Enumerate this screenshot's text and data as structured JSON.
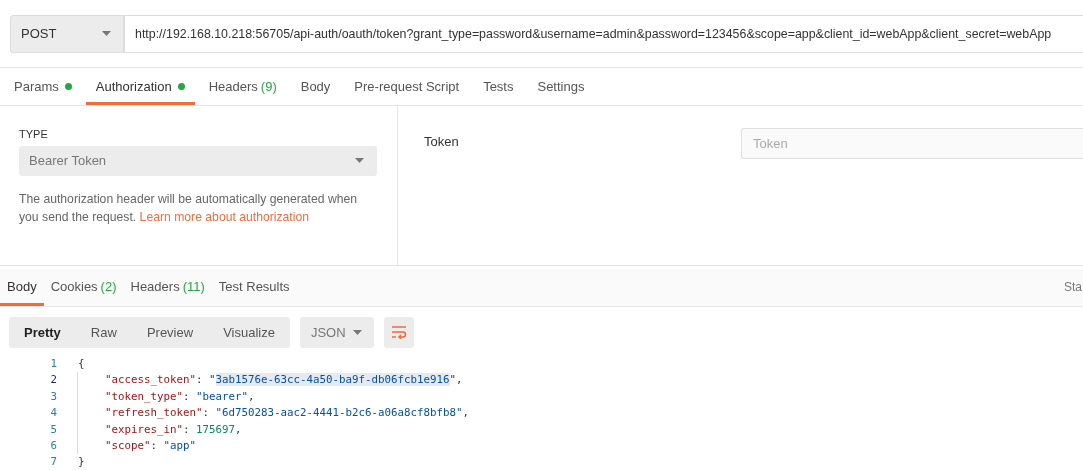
{
  "request": {
    "method": "POST",
    "url": "http://192.168.10.218:56705/api-auth/oauth/token?grant_type=password&username=admin&password=123456&scope=app&client_id=webApp&client_secret=webApp"
  },
  "request_tabs": [
    {
      "label": "Params",
      "dot": true,
      "selected": false
    },
    {
      "label": "Authorization",
      "dot": true,
      "selected": true
    },
    {
      "label": "Headers",
      "count": "(9)",
      "dot": false,
      "selected": false
    },
    {
      "label": "Body",
      "dot": false,
      "selected": false
    },
    {
      "label": "Pre-request Script",
      "dot": false,
      "selected": false
    },
    {
      "label": "Tests",
      "dot": false,
      "selected": false
    },
    {
      "label": "Settings",
      "dot": false,
      "selected": false
    }
  ],
  "authorization": {
    "type_label": "TYPE",
    "type_value": "Bearer Token",
    "help_text": "The authorization header will be automatically generated when you send the request.",
    "help_link": "Learn more about authorization",
    "token_label": "Token",
    "token_placeholder": "Token"
  },
  "response_tabs": [
    {
      "label": "Body",
      "selected": true
    },
    {
      "label": "Cookies",
      "count": "(2)",
      "selected": false
    },
    {
      "label": "Headers",
      "count": "(11)",
      "selected": false
    },
    {
      "label": "Test Results",
      "selected": false
    }
  ],
  "status_cut": "Sta",
  "view_modes": [
    {
      "label": "Pretty",
      "selected": true
    },
    {
      "label": "Raw",
      "selected": false
    },
    {
      "label": "Preview",
      "selected": false
    },
    {
      "label": "Visualize",
      "selected": false
    }
  ],
  "format": "JSON",
  "code_lines": [
    {
      "number": "1",
      "selected": false,
      "tokens": [
        {
          "kind": "punct",
          "text": "{",
          "highlighted": false
        }
      ]
    },
    {
      "number": "2",
      "selected": true,
      "tokens": [
        {
          "kind": "key",
          "text": "\"access_token\"",
          "highlighted": false
        },
        {
          "kind": "punct",
          "text": ": \"",
          "highlighted": false
        },
        {
          "kind": "string",
          "text": "3ab1576e-63cc-4a50-ba9f-db06fcb1e916",
          "highlighted": true
        },
        {
          "kind": "punct",
          "text": "\",",
          "highlighted": false
        }
      ]
    },
    {
      "number": "3",
      "selected": false,
      "tokens": [
        {
          "kind": "key",
          "text": "\"token_type\"",
          "highlighted": false
        },
        {
          "kind": "punct",
          "text": ": ",
          "highlighted": false
        },
        {
          "kind": "string",
          "text": "\"bearer\"",
          "highlighted": false
        },
        {
          "kind": "punct",
          "text": ",",
          "highlighted": false
        }
      ]
    },
    {
      "number": "4",
      "selected": false,
      "tokens": [
        {
          "kind": "key",
          "text": "\"refresh_token\"",
          "highlighted": false
        },
        {
          "kind": "punct",
          "text": ": ",
          "highlighted": false
        },
        {
          "kind": "string",
          "text": "\"6d750283-aac2-4441-b2c6-a06a8cf8bfb8\"",
          "highlighted": false
        },
        {
          "kind": "punct",
          "text": ",",
          "highlighted": false
        }
      ]
    },
    {
      "number": "5",
      "selected": false,
      "tokens": [
        {
          "kind": "key",
          "text": "\"expires_in\"",
          "highlighted": false
        },
        {
          "kind": "punct",
          "text": ": ",
          "highlighted": false
        },
        {
          "kind": "number",
          "text": "175697",
          "highlighted": false
        },
        {
          "kind": "punct",
          "text": ",",
          "highlighted": false
        }
      ]
    },
    {
      "number": "6",
      "selected": false,
      "tokens": [
        {
          "kind": "key",
          "text": "\"scope\"",
          "highlighted": false
        },
        {
          "kind": "punct",
          "text": ": ",
          "highlighted": false
        },
        {
          "kind": "string",
          "text": "\"app\"",
          "highlighted": false
        }
      ]
    },
    {
      "number": "7",
      "selected": false,
      "tokens": [
        {
          "kind": "punct",
          "text": "}",
          "highlighted": false
        }
      ]
    }
  ]
}
